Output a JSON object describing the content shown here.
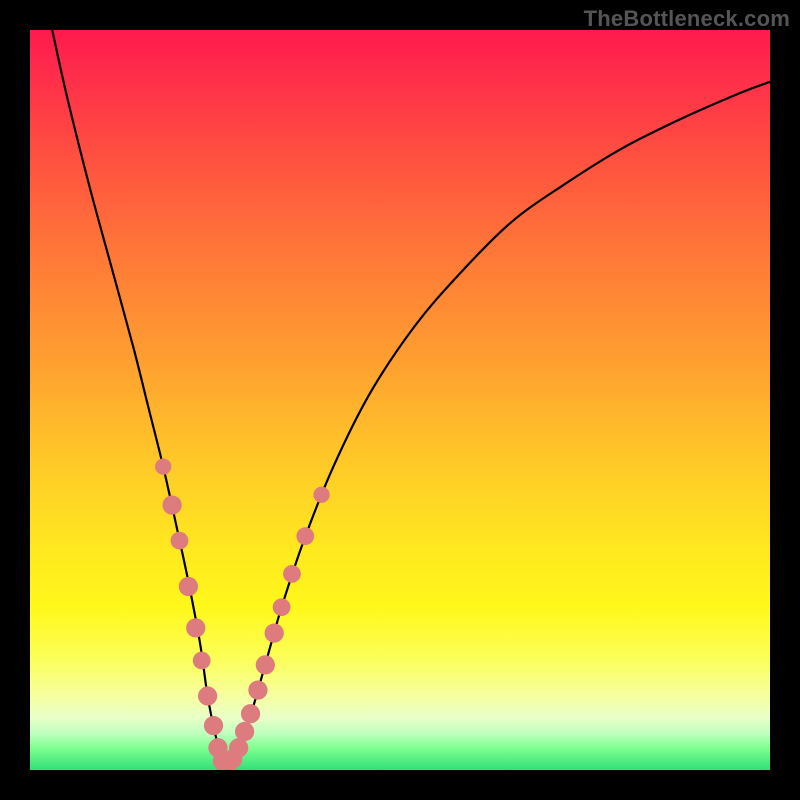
{
  "watermark": "TheBottleneck.com",
  "chart_data": {
    "type": "line",
    "title": "",
    "xlabel": "",
    "ylabel": "",
    "xlim": [
      0,
      100
    ],
    "ylim": [
      0,
      100
    ],
    "grid": false,
    "series": [
      {
        "name": "bottleneck-curve",
        "x": [
          3,
          5,
          8,
          11,
          14,
          16,
          18,
          20,
          21.5,
          23,
          24,
          25,
          25.8,
          26.5,
          27.3,
          28.5,
          30,
          32,
          34,
          37,
          41,
          46,
          52,
          58,
          65,
          72,
          80,
          88,
          96,
          100
        ],
        "y": [
          100,
          91,
          79,
          68,
          57,
          49,
          41,
          32,
          25,
          17,
          10,
          5,
          2,
          0.7,
          1.2,
          3.5,
          8,
          15,
          22,
          31,
          41,
          51,
          60,
          67,
          74,
          79,
          84,
          88,
          91.5,
          93
        ]
      }
    ],
    "markers": {
      "name": "highlighted-points",
      "color": "#de7b7e",
      "points": [
        {
          "x": 18.0,
          "y": 41.0,
          "r": 1.1
        },
        {
          "x": 19.2,
          "y": 35.8,
          "r": 1.3
        },
        {
          "x": 20.2,
          "y": 31.0,
          "r": 1.2
        },
        {
          "x": 21.4,
          "y": 24.8,
          "r": 1.3
        },
        {
          "x": 22.4,
          "y": 19.2,
          "r": 1.3
        },
        {
          "x": 23.2,
          "y": 14.8,
          "r": 1.2
        },
        {
          "x": 24.0,
          "y": 10.0,
          "r": 1.3
        },
        {
          "x": 24.8,
          "y": 6.0,
          "r": 1.3
        },
        {
          "x": 25.4,
          "y": 3.0,
          "r": 1.3
        },
        {
          "x": 26.0,
          "y": 1.2,
          "r": 1.3
        },
        {
          "x": 26.6,
          "y": 0.7,
          "r": 1.3
        },
        {
          "x": 27.4,
          "y": 1.5,
          "r": 1.3
        },
        {
          "x": 28.2,
          "y": 3.0,
          "r": 1.3
        },
        {
          "x": 29.0,
          "y": 5.2,
          "r": 1.3
        },
        {
          "x": 29.8,
          "y": 7.6,
          "r": 1.3
        },
        {
          "x": 30.8,
          "y": 10.8,
          "r": 1.3
        },
        {
          "x": 31.8,
          "y": 14.2,
          "r": 1.3
        },
        {
          "x": 33.0,
          "y": 18.5,
          "r": 1.3
        },
        {
          "x": 34.0,
          "y": 22.0,
          "r": 1.2
        },
        {
          "x": 35.4,
          "y": 26.5,
          "r": 1.2
        },
        {
          "x": 37.2,
          "y": 31.6,
          "r": 1.2
        },
        {
          "x": 39.4,
          "y": 37.2,
          "r": 1.1
        }
      ]
    }
  }
}
